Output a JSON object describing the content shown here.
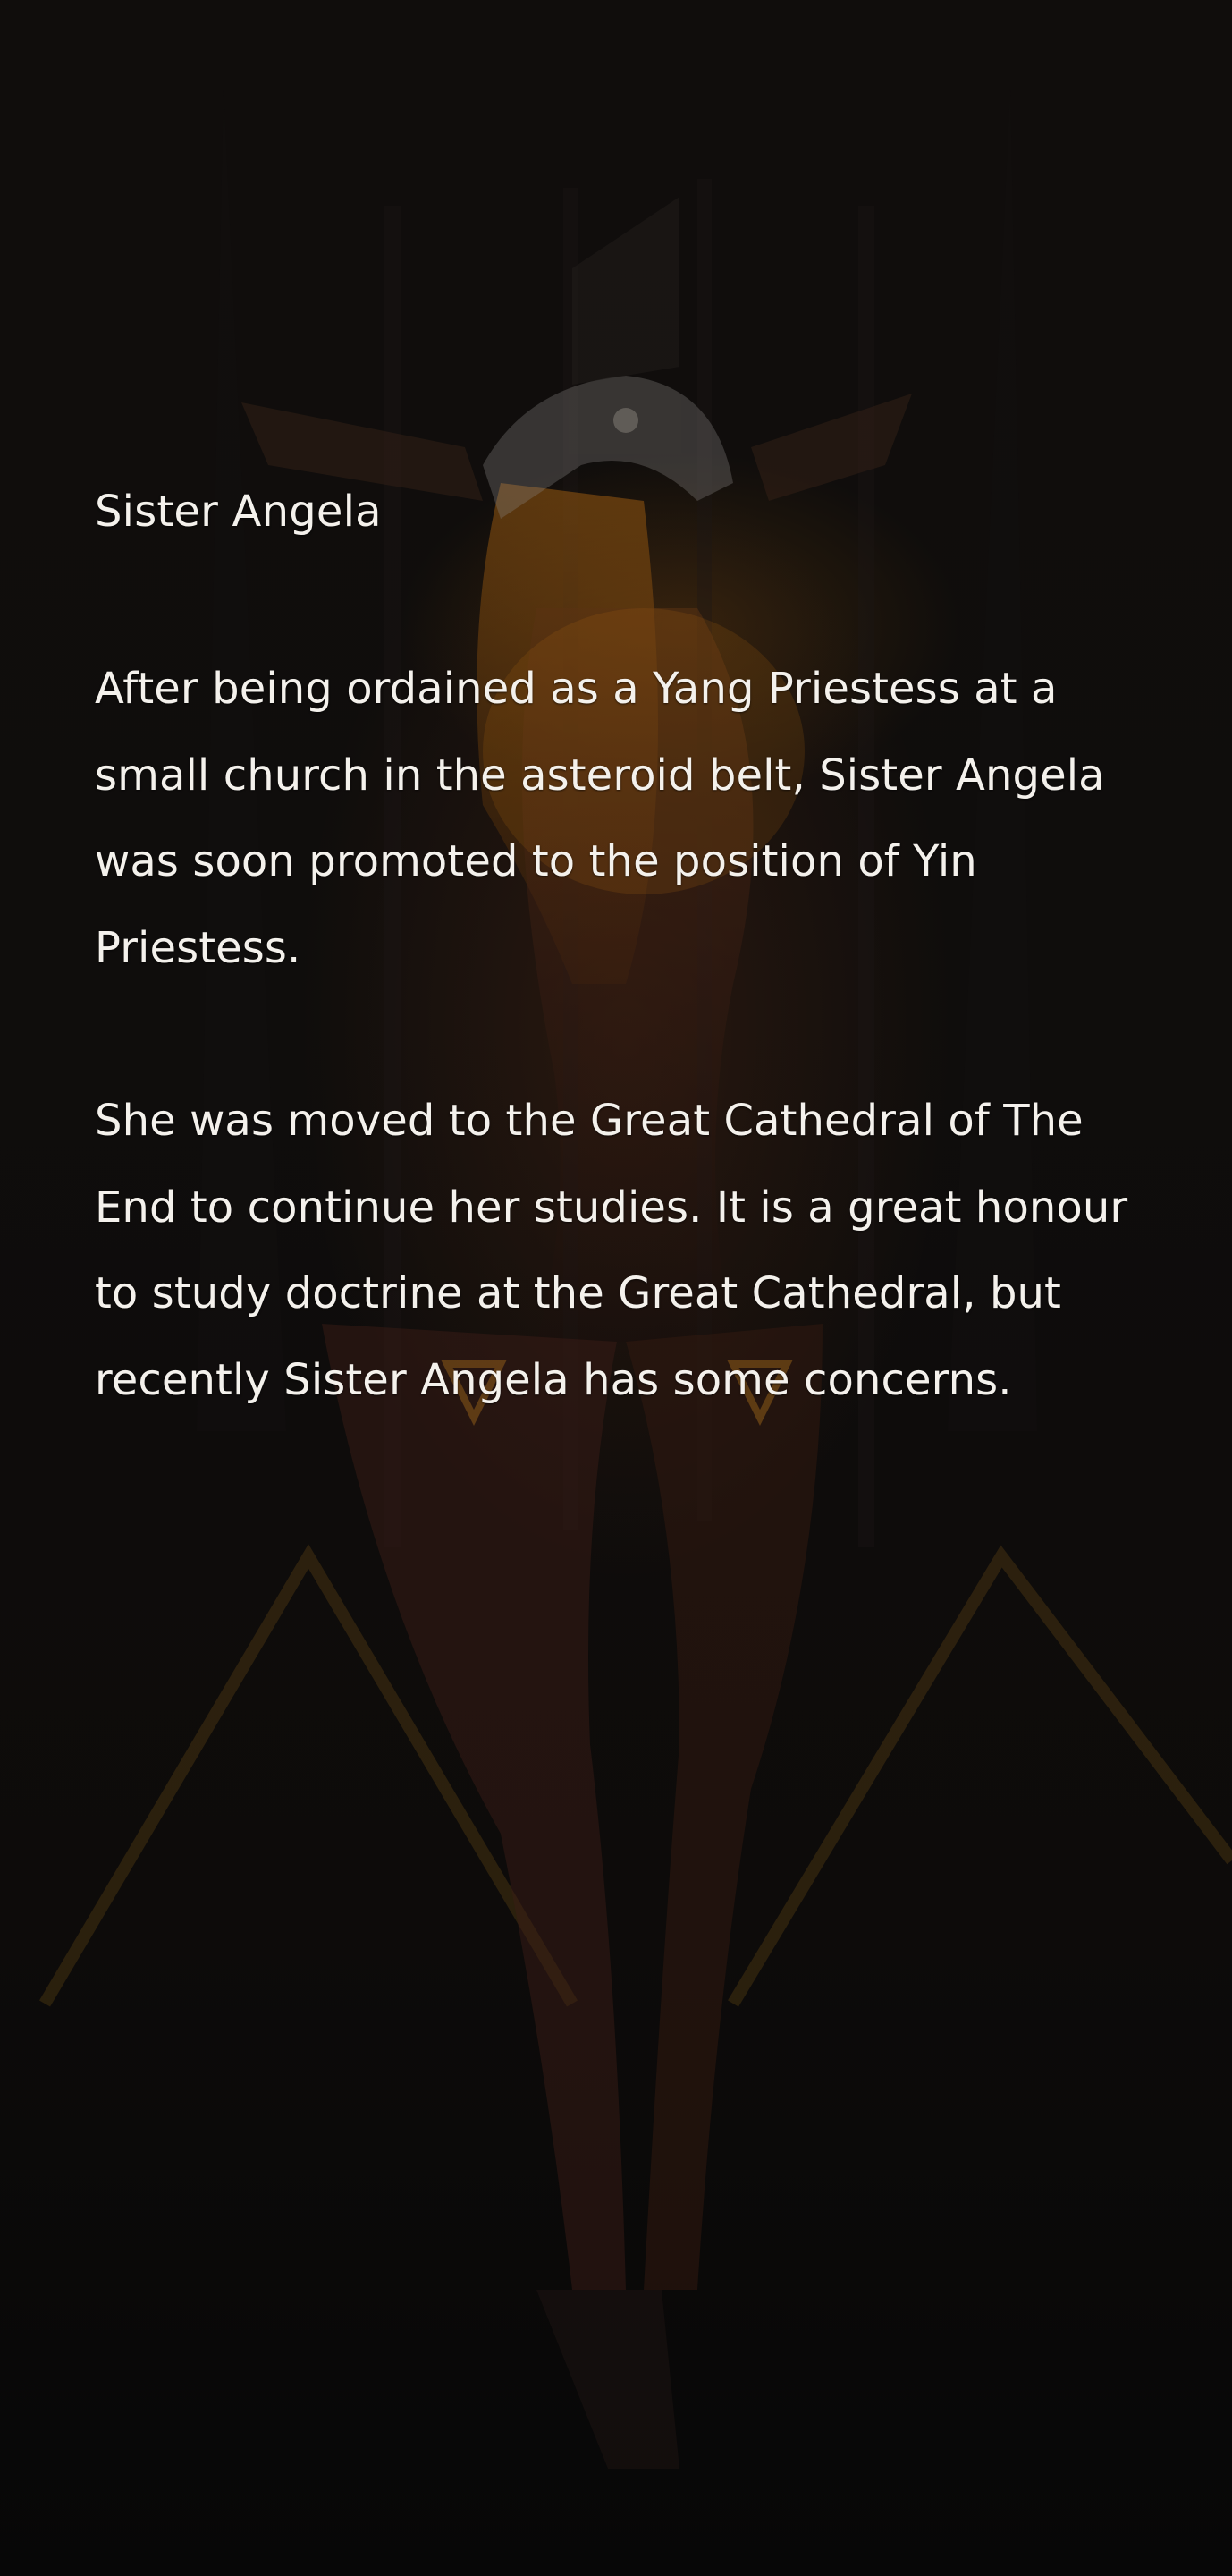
{
  "story": {
    "title": "Sister Angela",
    "paragraphs": [
      "After being ordained as a Yang Priestess at a small church in the asteroid belt, Sister Angela was soon promoted to the position of Yin Priestess.",
      "She was moved to the Great Cathedral of The End to continue her studies. It is a great honour to study doctrine at the Great Cathedral, but recently Sister Angela has some concerns."
    ]
  },
  "background": {
    "description_icon": "character-portrait-icon",
    "accent_color": "#c8861a",
    "base_color": "#0b0a09",
    "text_color": "#f4f1ec"
  }
}
